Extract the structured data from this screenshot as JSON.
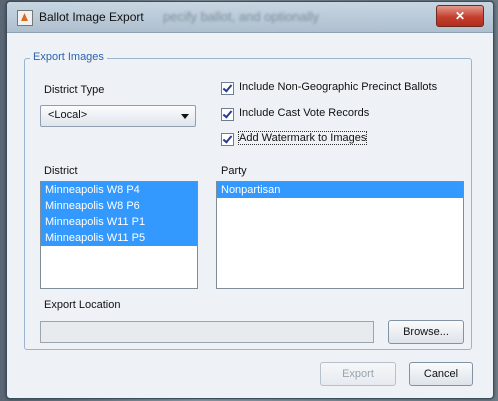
{
  "window": {
    "title": "Ballot Image Export",
    "title_overlay": "pecify ballot, and optionally",
    "close_glyph": "✕"
  },
  "group": {
    "title": "Export Images"
  },
  "district_type": {
    "label": "District Type",
    "selected": "<Local>"
  },
  "checkboxes": [
    {
      "label": "Include Non-Geographic Precinct Ballots",
      "checked": true
    },
    {
      "label": "Include Cast Vote Records",
      "checked": true
    },
    {
      "label": "Add Watermark to Images",
      "checked": true
    }
  ],
  "district": {
    "label": "District",
    "items": [
      "Minneapolis W8 P4",
      "Minneapolis W8 P6",
      "Minneapolis W11 P1",
      "Minneapolis W11 P5"
    ]
  },
  "party": {
    "label": "Party",
    "items": [
      "Nonpartisan"
    ]
  },
  "export_location": {
    "label": "Export Location",
    "value": ""
  },
  "buttons": {
    "browse": "Browse...",
    "export": "Export",
    "cancel": "Cancel"
  },
  "colors": {
    "selection": "#3399ff",
    "group_title": "#2b64b0",
    "close_button": "#c4402e"
  }
}
